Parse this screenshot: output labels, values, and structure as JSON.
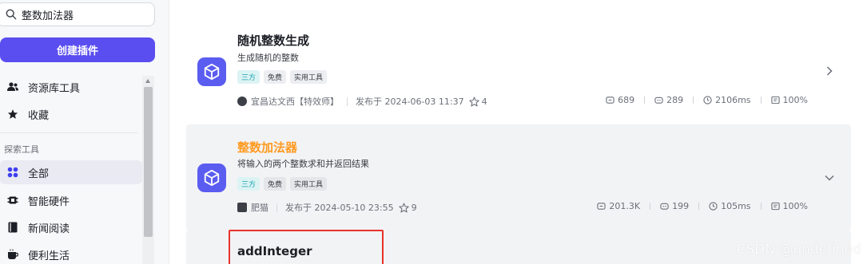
{
  "sidebar": {
    "search": {
      "value": "整数加法器",
      "placeholder": ""
    },
    "create_button": "创建插件",
    "items_top": [
      {
        "label": "资源库工具",
        "icon": "users-icon"
      },
      {
        "label": "收藏",
        "icon": "star-filled-icon"
      }
    ],
    "section_label": "探索工具",
    "items_explore": [
      {
        "label": "全部",
        "icon": "grid-icon",
        "active": true
      },
      {
        "label": "智能硬件",
        "icon": "chip-icon"
      },
      {
        "label": "新闻阅读",
        "icon": "book-icon"
      },
      {
        "label": "便利生活",
        "icon": "cup-icon"
      }
    ]
  },
  "plugins": [
    {
      "title": "随机整数生成",
      "description": "生成随机的整数",
      "tags": [
        "三方",
        "免费",
        "实用工具"
      ],
      "author": "宜昌达文西【特效师】",
      "published": "发布于 2024-06-03 11:37",
      "stars": "4",
      "stats": {
        "uses": "689",
        "bots": "289",
        "latency": "2106ms",
        "success": "100%"
      }
    },
    {
      "title": "整数加法器",
      "description": "将输入的两个整数求和并返回结果",
      "tags": [
        "三方",
        "免费",
        "实用工具"
      ],
      "author": "肥猫",
      "published": "发布于 2024-05-10 23:55",
      "stars": "9",
      "stats": {
        "uses": "201.3K",
        "bots": "199",
        "latency": "105ms",
        "success": "100%"
      }
    }
  ],
  "function": {
    "name": "addInteger"
  },
  "watermark": "CSDN @undefined",
  "colors": {
    "accent": "#5a4ef0",
    "highlight": "#ff9a1f",
    "tag_blue": "#1aa4b0",
    "annotation_red": "#e8322a"
  }
}
